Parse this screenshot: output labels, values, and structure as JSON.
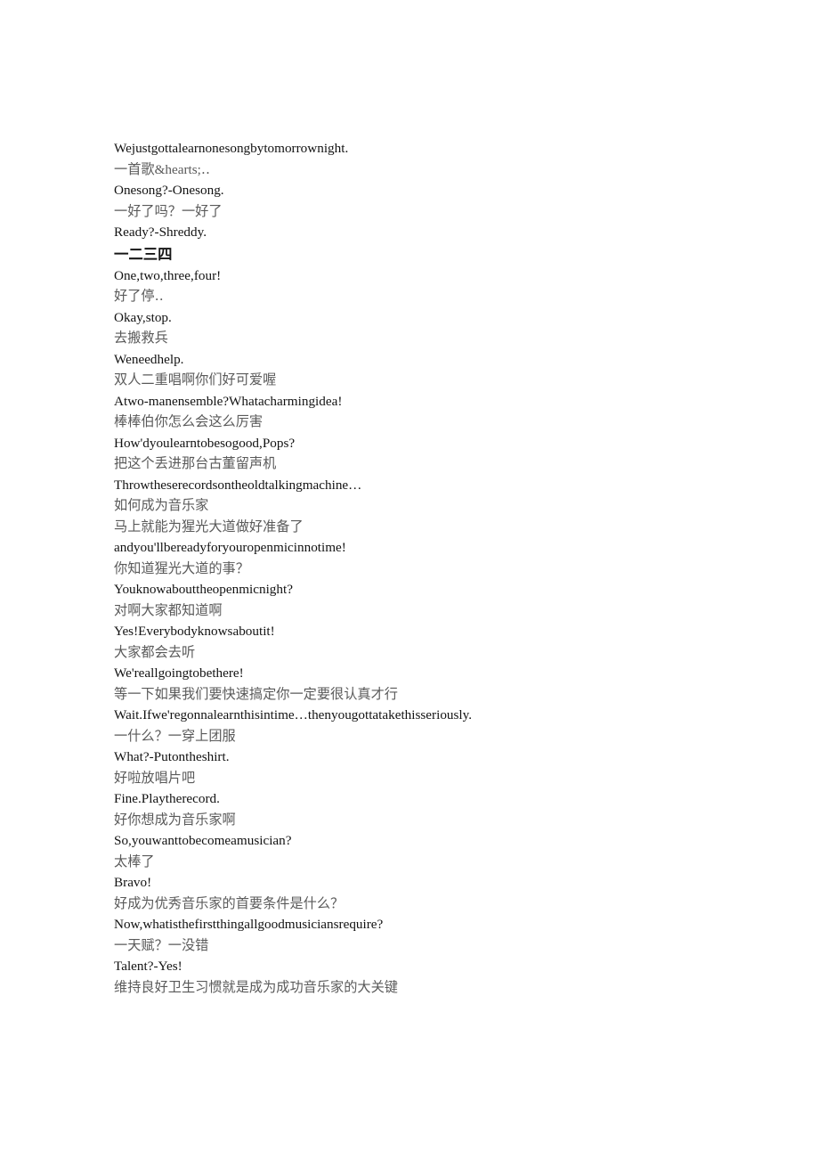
{
  "document": {
    "type": "bilingual-subtitle-transcript",
    "background_color": "#ffffff",
    "latin_text_color": "#121212",
    "chinese_text_color": "#5a5a5a",
    "emphasis_text_color": "#161616",
    "lines": [
      {
        "lang": "en",
        "text": "Wejustgottalearnonesongbytomorrownight."
      },
      {
        "lang": "zh",
        "text": "一首歌&hearts;‥"
      },
      {
        "lang": "en",
        "text": "Onesong?-Onesong."
      },
      {
        "lang": "zh",
        "text": "一好了吗？一好了"
      },
      {
        "lang": "en",
        "text": "Ready?-Shreddy."
      },
      {
        "lang": "zh-strong",
        "text": "一二三四"
      },
      {
        "lang": "en",
        "text": "One,two,three,four!"
      },
      {
        "lang": "zh",
        "text": "好了停‥"
      },
      {
        "lang": "en",
        "text": "Okay,stop."
      },
      {
        "lang": "zh",
        "text": "去搬救兵"
      },
      {
        "lang": "en",
        "text": "Weneedhelp."
      },
      {
        "lang": "zh",
        "text": "双人二重唱啊你们好可爱喔"
      },
      {
        "lang": "en",
        "text": "Atwo-manensemble?Whatacharmingidea!"
      },
      {
        "lang": "zh",
        "text": "棒棒伯你怎么会这么厉害"
      },
      {
        "lang": "en",
        "text": "How'dyoulearntobesogood,Pops?"
      },
      {
        "lang": "zh",
        "text": "把这个丢进那台古董留声机"
      },
      {
        "lang": "en",
        "text": "Throwtheserecordsontheoldtalkingmachine…"
      },
      {
        "lang": "zh",
        "text": "如何成为音乐家"
      },
      {
        "lang": "zh",
        "text": "马上就能为猩光大道做好准备了"
      },
      {
        "lang": "en",
        "text": "andyou'llbereadyforyouropenmicinnotime!"
      },
      {
        "lang": "zh",
        "text": "你知道猩光大道的事？"
      },
      {
        "lang": "en",
        "text": "Youknowabouttheopenmicnight?"
      },
      {
        "lang": "zh",
        "text": "对啊大家都知道啊"
      },
      {
        "lang": "en",
        "text": "Yes!Everybodyknowsaboutit!"
      },
      {
        "lang": "zh",
        "text": "大家都会去听"
      },
      {
        "lang": "en",
        "text": "We'reallgoingtobethere!"
      },
      {
        "lang": "zh",
        "text": "等一下如果我们要快速搞定你一定要很认真才行"
      },
      {
        "lang": "en",
        "text": "Wait.Ifwe'regonnalearnthisintime…thenyougottatakethisseriously."
      },
      {
        "lang": "zh",
        "text": "一什么？一穿上团服"
      },
      {
        "lang": "en",
        "text": "What?-Putontheshirt."
      },
      {
        "lang": "zh",
        "text": "好啦放唱片吧"
      },
      {
        "lang": "en",
        "text": "Fine.Playtherecord."
      },
      {
        "lang": "zh",
        "text": "好你想成为音乐家啊"
      },
      {
        "lang": "en",
        "text": "So,youwanttobecomeamusician?"
      },
      {
        "lang": "zh",
        "text": "太棒了"
      },
      {
        "lang": "en",
        "text": "Bravo!"
      },
      {
        "lang": "zh",
        "text": "好成为优秀音乐家的首要条件是什么？"
      },
      {
        "lang": "en",
        "text": "Now,whatisthefirstthingallgoodmusiciansrequire?"
      },
      {
        "lang": "zh",
        "text": "一天赋？一没错"
      },
      {
        "lang": "en",
        "text": "Talent?-Yes!"
      },
      {
        "lang": "zh",
        "text": "维持良好卫生习惯就是成为成功音乐家的大关键"
      }
    ]
  }
}
